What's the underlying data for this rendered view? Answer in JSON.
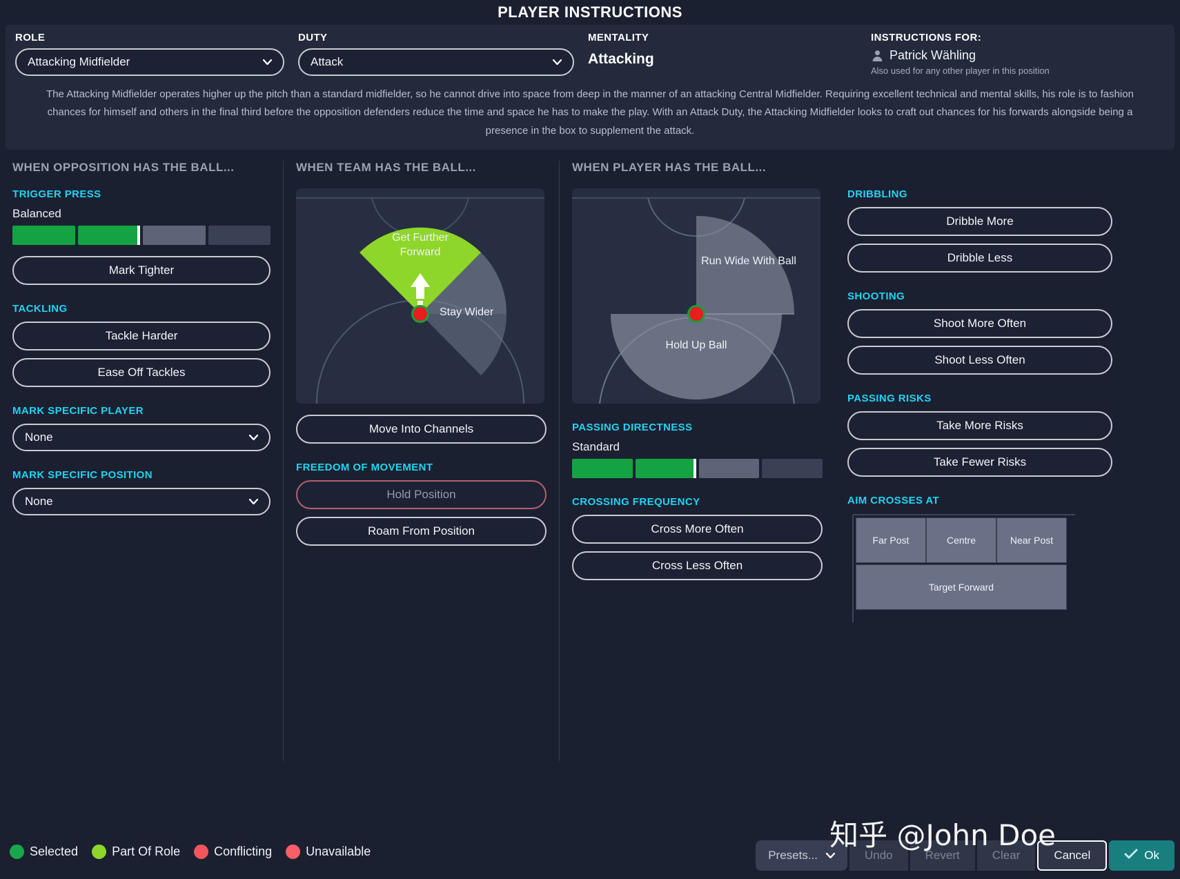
{
  "header": {
    "title": "PLAYER INSTRUCTIONS",
    "role_caption": "ROLE",
    "role_value": "Attacking Midfielder",
    "duty_caption": "DUTY",
    "duty_value": "Attack",
    "mentality_caption": "MENTALITY",
    "mentality_value": "Attacking",
    "instructions_caption": "INSTRUCTIONS FOR:",
    "player_name": "Patrick Wähling",
    "instructions_note": "Also used for any other player in this position",
    "description": "The Attacking Midfielder operates higher up the pitch than a standard midfielder, so he cannot drive into space from deep in the manner of an attacking Central Midfielder. Requiring excellent technical and mental skills, his role is to fashion chances for himself and others in the final third before the opposition defenders reduce the time and space he has to make the play. With an Attack Duty, the Attacking Midfielder looks to craft out chances for his forwards alongside being a presence in the box to supplement the attack."
  },
  "columns": {
    "opposition": {
      "heading": "WHEN OPPOSITION HAS THE BALL...",
      "trigger_press": {
        "label": "TRIGGER PRESS",
        "value": "Balanced",
        "segments": [
          "on",
          "on",
          "mid",
          "off"
        ],
        "marker_segment": 1
      },
      "mark_tighter": "Mark Tighter",
      "tackling": {
        "label": "TACKLING",
        "harder": "Tackle Harder",
        "ease": "Ease Off Tackles"
      },
      "mark_player": {
        "label": "MARK SPECIFIC PLAYER",
        "value": "None"
      },
      "mark_position": {
        "label": "MARK SPECIFIC POSITION",
        "value": "None"
      }
    },
    "team": {
      "heading": "WHEN TEAM HAS THE BALL...",
      "pitch_labels": {
        "forward": "Get Further Forward",
        "wider": "Stay Wider"
      },
      "move_into_channels": "Move Into Channels",
      "freedom": {
        "label": "FREEDOM OF MOVEMENT",
        "hold": "Hold Position",
        "roam": "Roam From Position"
      }
    },
    "player": {
      "heading": "WHEN PLAYER HAS THE BALL...",
      "pitch_labels": {
        "run_wide": "Run Wide With Ball",
        "hold_up": "Hold Up Ball"
      },
      "passing_directness": {
        "label": "PASSING DIRECTNESS",
        "value": "Standard",
        "segments": [
          "on",
          "on",
          "mid",
          "off"
        ],
        "marker_segment": 1
      },
      "crossing": {
        "label": "CROSSING FREQUENCY",
        "more": "Cross More Often",
        "less": "Cross Less Often"
      }
    },
    "attributes": {
      "dribbling": {
        "label": "DRIBBLING",
        "more": "Dribble More",
        "less": "Dribble Less"
      },
      "shooting": {
        "label": "SHOOTING",
        "more": "Shoot More Often",
        "less": "Shoot Less Often"
      },
      "passing_risks": {
        "label": "PASSING RISKS",
        "more": "Take More Risks",
        "less": "Take Fewer Risks"
      },
      "aim_crosses": {
        "label": "AIM CROSSES AT",
        "cells": [
          "Far Post",
          "Centre",
          "Near Post"
        ],
        "target": "Target Forward"
      }
    }
  },
  "footer": {
    "legend": [
      {
        "label": "Selected",
        "color": "#18a84a"
      },
      {
        "label": "Part Of Role",
        "color": "#8ed629"
      },
      {
        "label": "Conflicting",
        "color": "#f2555c"
      },
      {
        "label": "Unavailable",
        "color": "#fa5f68"
      }
    ],
    "presets": "Presets...",
    "undo": "Undo",
    "revert": "Revert",
    "clear": "Clear",
    "cancel": "Cancel",
    "ok": "Ok",
    "watermark": "知乎 @John Doe"
  }
}
